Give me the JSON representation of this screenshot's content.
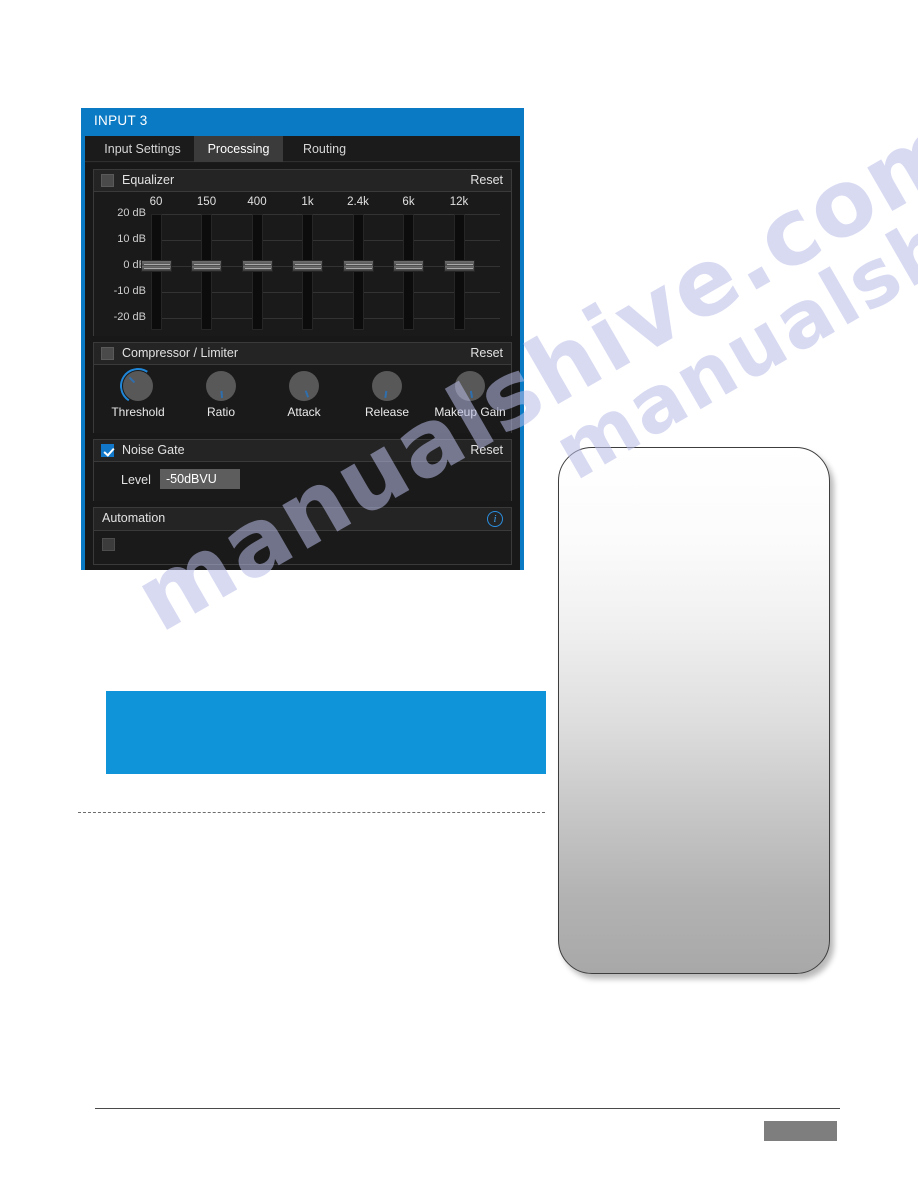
{
  "panel": {
    "title": "INPUT 3",
    "tabs": [
      {
        "label": "Input Settings",
        "active": false
      },
      {
        "label": "Processing",
        "active": true
      },
      {
        "label": "Routing",
        "active": false
      }
    ],
    "equalizer": {
      "title": "Equalizer",
      "reset_label": "Reset",
      "enabled": false,
      "bands": [
        {
          "freq": "60",
          "value_db": 0
        },
        {
          "freq": "150",
          "value_db": 0
        },
        {
          "freq": "400",
          "value_db": 0
        },
        {
          "freq": "1k",
          "value_db": 0
        },
        {
          "freq": "2.4k",
          "value_db": 0
        },
        {
          "freq": "6k",
          "value_db": 0
        },
        {
          "freq": "12k",
          "value_db": 0
        }
      ],
      "scale": [
        "20 dB",
        "10 dB",
        "0 dB",
        "-10 dB",
        "-20 dB"
      ]
    },
    "compressor": {
      "title": "Compressor / Limiter",
      "reset_label": "Reset",
      "enabled": false,
      "knobs": [
        {
          "label": "Threshold",
          "active": true
        },
        {
          "label": "Ratio",
          "active": false
        },
        {
          "label": "Attack",
          "active": false
        },
        {
          "label": "Release",
          "active": false
        },
        {
          "label": "Makeup Gain",
          "active": false
        }
      ]
    },
    "noise_gate": {
      "title": "Noise Gate",
      "reset_label": "Reset",
      "enabled": true,
      "level_label": "Level",
      "level_value": "-50dBVU"
    },
    "automation": {
      "title": "Automation",
      "info_icon": "i"
    }
  },
  "watermark": {
    "line_a": "manualshive.com",
    "line_b": "manualshive.com"
  },
  "colors": {
    "accent_blue": "#0a7ac4",
    "callout_blue": "#0f94d9",
    "checkbox_blue": "#1178c9",
    "panel_dark": "#1b1b1b"
  }
}
